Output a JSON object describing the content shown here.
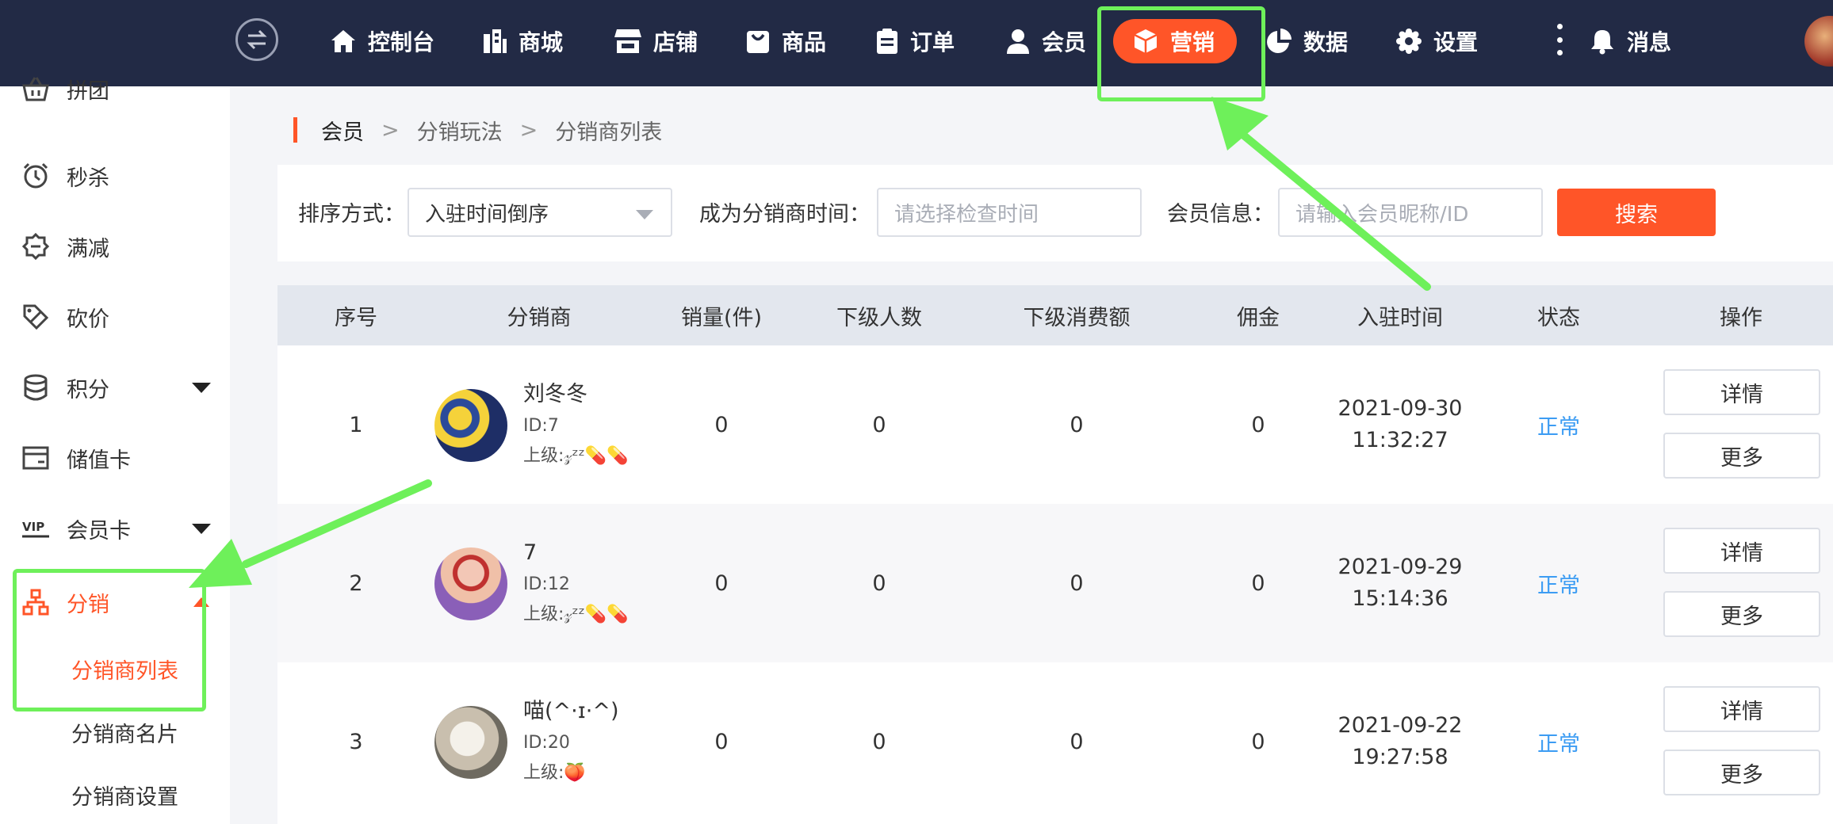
{
  "topnav": {
    "items": [
      {
        "label": "控制台",
        "icon": "home-icon"
      },
      {
        "label": "商城",
        "icon": "building-icon"
      },
      {
        "label": "店铺",
        "icon": "store-icon"
      },
      {
        "label": "商品",
        "icon": "bag-icon"
      },
      {
        "label": "订单",
        "icon": "clipboard-icon"
      },
      {
        "label": "会员",
        "icon": "user-icon"
      },
      {
        "label": "营销",
        "icon": "cube-icon",
        "active": true
      },
      {
        "label": "数据",
        "icon": "pie-icon"
      },
      {
        "label": "设置",
        "icon": "gear-icon"
      }
    ],
    "messages_label": "消息"
  },
  "sidebar": {
    "items": [
      {
        "label": "拼团",
        "icon": "basket-icon"
      },
      {
        "label": "秒杀",
        "icon": "alarm-clock-icon"
      },
      {
        "label": "满减",
        "icon": "badge-icon"
      },
      {
        "label": "砍价",
        "icon": "discount-tag-icon"
      },
      {
        "label": "积分",
        "icon": "database-icon"
      },
      {
        "label": "储值卡",
        "icon": "card-icon"
      },
      {
        "label": "会员卡",
        "icon": "vip-icon"
      },
      {
        "label": "分销",
        "icon": "org-chart-icon"
      }
    ],
    "sub_items": [
      "分销商列表",
      "分销商名片",
      "分销商设置"
    ]
  },
  "breadcrumb": [
    "会员",
    "分销玩法",
    "分销商列表"
  ],
  "filters": {
    "sort_label": "排序方式：",
    "sort_value": "入驻时间倒序",
    "time_label": "成为分销商时间：",
    "time_placeholder": "请选择检查时间",
    "member_label": "会员信息：",
    "member_placeholder": "请输入会员昵称/ID",
    "search_button": "搜索"
  },
  "table": {
    "headers": [
      "序号",
      "分销商",
      "销量(件)",
      "下级人数",
      "下级消费额",
      "佣金",
      "入驻时间",
      "状态",
      "操作"
    ],
    "rows": [
      {
        "index": "1",
        "name": "刘冬冬",
        "id": "ID:7",
        "parent": "上级:𝓏ᶻᶻ💊💊",
        "sales": "0",
        "subs": "0",
        "sub_spend": "0",
        "commission": "0",
        "date": "2021-09-30",
        "time": "11:32:27",
        "status": "正常"
      },
      {
        "index": "2",
        "name": "7",
        "id": "ID:12",
        "parent": "上级:𝓏ᶻᶻ💊💊",
        "sales": "0",
        "subs": "0",
        "sub_spend": "0",
        "commission": "0",
        "date": "2021-09-29",
        "time": "15:14:36",
        "status": "正常"
      },
      {
        "index": "3",
        "name": "喵(^·ɪ·^)",
        "id": "ID:20",
        "parent": "上级:🍑",
        "sales": "0",
        "subs": "0",
        "sub_spend": "0",
        "commission": "0",
        "date": "2021-09-22",
        "time": "19:27:58",
        "status": "正常"
      }
    ],
    "detail_button": "详情",
    "more_button": "更多"
  },
  "colors": {
    "nav_bg": "#222a45",
    "accent": "#ff5528",
    "status_blue": "#3c9cf3",
    "annotation_green": "#6ef05a"
  }
}
